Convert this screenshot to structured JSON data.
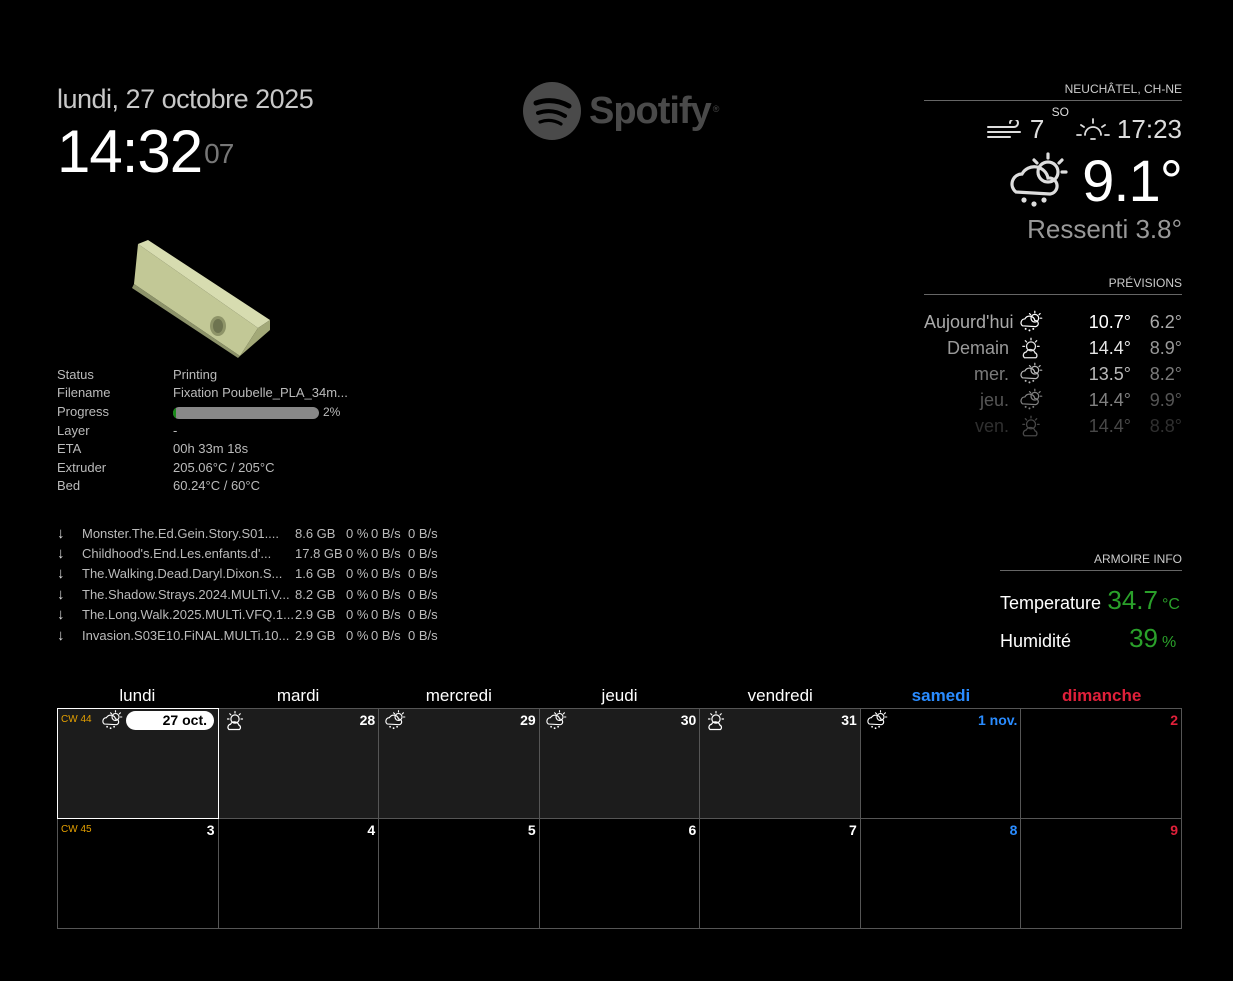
{
  "clock": {
    "date": "lundi, 27 octobre 2025",
    "time": "14:32",
    "seconds": "07"
  },
  "spotify": {
    "logo": "Spotify",
    "trademark": "®"
  },
  "printer": {
    "rows": [
      {
        "label": "Status",
        "value": "Printing"
      },
      {
        "label": "Filename",
        "value": "Fixation Poubelle_PLA_34m..."
      },
      {
        "label": "Progress",
        "value": "2%",
        "progress": 0.02
      },
      {
        "label": "Layer",
        "value": "-"
      },
      {
        "label": "ETA",
        "value": "00h 33m 18s"
      },
      {
        "label": "Extruder",
        "value": "205.06°C / 205°C"
      },
      {
        "label": "Bed",
        "value": "60.24°C / 60°C"
      }
    ]
  },
  "torrents": [
    {
      "name": "Monster.The.Ed.Gein.Story.S01....",
      "size": "8.6 GB",
      "pct": "0 %",
      "down": "0 B/s",
      "up": "0 B/s"
    },
    {
      "name": "Childhood's.End.Les.enfants.d'...",
      "size": "17.8 GB",
      "pct": "0 %",
      "down": "0 B/s",
      "up": "0 B/s"
    },
    {
      "name": "The.Walking.Dead.Daryl.Dixon.S...",
      "size": "1.6 GB",
      "pct": "0 %",
      "down": "0 B/s",
      "up": "0 B/s"
    },
    {
      "name": "The.Shadow.Strays.2024.MULTi.V...",
      "size": "8.2 GB",
      "pct": "0 %",
      "down": "0 B/s",
      "up": "0 B/s"
    },
    {
      "name": "The.Long.Walk.2025.MULTi.VFQ.1...",
      "size": "2.9 GB",
      "pct": "0 %",
      "down": "0 B/s",
      "up": "0 B/s"
    },
    {
      "name": "Invasion.S03E10.FiNAL.MULTi.10...",
      "size": "2.9 GB",
      "pct": "0 %",
      "down": "0 B/s",
      "up": "0 B/s"
    }
  ],
  "weather": {
    "location": "NEUCHÂTEL, CH-NE",
    "wind_speed": "7",
    "wind_dir": "SO",
    "sunset": "17:23",
    "temperature": "9.1°",
    "feels_like": "Ressenti 3.8°",
    "icon": "cloud-sun-rain-icon"
  },
  "forecast": {
    "header": "PRÉVISIONS",
    "days": [
      {
        "day": "Aujourd'hui",
        "icon": "cloud-sun-rain-icon",
        "max": "10.7°",
        "min": "6.2°"
      },
      {
        "day": "Demain",
        "icon": "sun-cloud-icon",
        "max": "14.4°",
        "min": "8.9°"
      },
      {
        "day": "mer.",
        "icon": "cloud-sun-rain-icon",
        "max": "13.5°",
        "min": "8.2°"
      },
      {
        "day": "jeu.",
        "icon": "cloud-sun-rain-icon",
        "max": "14.4°",
        "min": "9.9°"
      },
      {
        "day": "ven.",
        "icon": "sun-cloud-icon",
        "max": "14.4°",
        "min": "8.8°"
      }
    ]
  },
  "armoire": {
    "header": "ARMOIRE INFO",
    "temperature_label": "Temperature",
    "temperature": "34.7",
    "temperature_unit": "°C",
    "humidity_label": "Humidité",
    "humidity": "39",
    "humidity_unit": "%"
  },
  "calendar": {
    "weekdays": [
      "lundi",
      "mardi",
      "mercredi",
      "jeudi",
      "vendredi",
      "samedi",
      "dimanche"
    ],
    "weeks": [
      {
        "cw": "CW 44",
        "days": [
          {
            "num": "27 oct.",
            "today": true,
            "icon": "cloud-sun-rain-icon"
          },
          {
            "num": "28",
            "icon": "sun-cloud-icon"
          },
          {
            "num": "29",
            "icon": "cloud-sun-rain-icon"
          },
          {
            "num": "30",
            "icon": "cloud-sun-rain-icon"
          },
          {
            "num": "31",
            "icon": "sun-cloud-icon"
          },
          {
            "num": "1 nov.",
            "icon": "cloud-sun-rain-icon"
          },
          {
            "num": "2"
          }
        ]
      },
      {
        "cw": "CW 45",
        "days": [
          {
            "num": "3"
          },
          {
            "num": "4"
          },
          {
            "num": "5"
          },
          {
            "num": "6"
          },
          {
            "num": "7"
          },
          {
            "num": "8"
          },
          {
            "num": "9"
          }
        ]
      }
    ]
  },
  "colors": {
    "accent_green": "#2aa02a",
    "saturday": "#2a8cff",
    "sunday": "#e0203a",
    "week_number": "#e5a000"
  }
}
